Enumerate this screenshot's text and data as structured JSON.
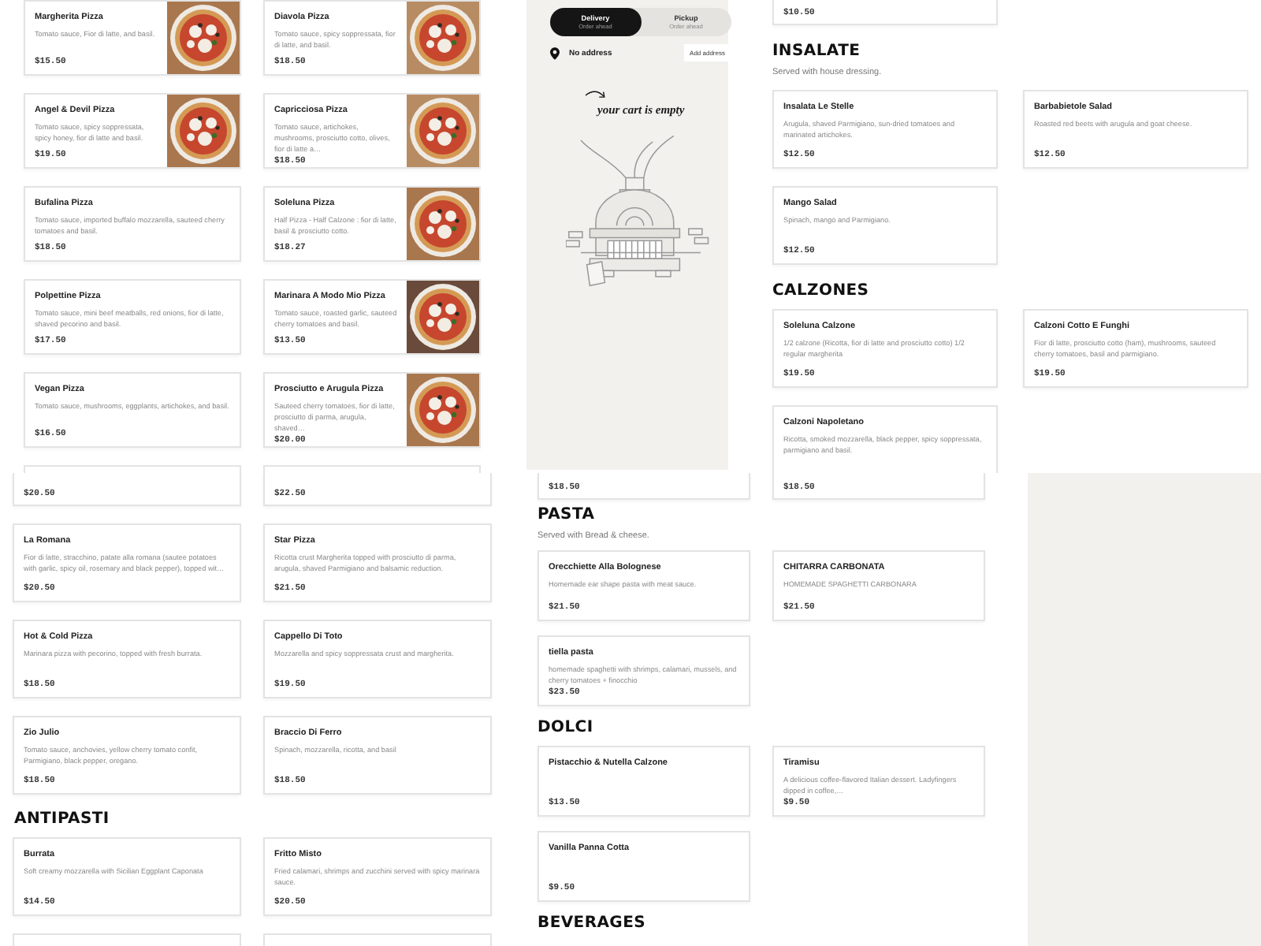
{
  "panels": [
    {
      "kind": "menu",
      "sections": [
        {
          "items": [
            {
              "name": "Margherita Pizza",
              "description": "Tomato sauce, Fior di latte, and basil.",
              "price": "$15.50"
            },
            {
              "name": "Diavola Pizza",
              "description": "Tomato sauce, spicy soppressata, fior di latte, and basil.",
              "price": "$18.50"
            },
            {
              "name": "Angel & Devil Pizza",
              "description": "Tomato sauce, spicy soppressata, spicy honey, fior di latte and basil.",
              "price": "$19.50"
            },
            {
              "name": "Capricciosa Pizza",
              "description": "Tomato sauce, artichokes, mushrooms, prosciutto cotto, olives, fior di latte a…",
              "price": "$18.50"
            },
            {
              "kind": "dish",
              "name": "Bufalina Pizza",
              "description": "Tomato sauce, imported buffalo mozzarella, sauteed cherry tomatoes and basil.",
              "price": "$18.50"
            },
            {
              "name": "Soleluna Pizza",
              "description": "Half Pizza - Half Calzone : fior di latte, basil & prosciutto cotto.",
              "price": "$18.27"
            },
            {
              "kind": "dish",
              "name": "Polpettine Pizza",
              "description": "Tomato sauce, mini beef meatballs, red onions, fior di latte, shaved pecorino and basil.",
              "price": "$17.50"
            },
            {
              "name": "Marinara A Modo Mio Pizza",
              "description": "Tomato sauce, roasted garlic, sauteed cherry tomatoes and basil.",
              "price": "$13.50"
            },
            {
              "kind": "dish",
              "name": "Vegan Pizza",
              "description": "Tomato sauce, mushrooms, eggplants, artichokes, and basil.",
              "price": "$16.50"
            },
            {
              "name": "Prosciutto e Arugula Pizza",
              "description": "Sauteed cherry tomatoes, fior di latte, prosciutto di parma, arugula, shaved…",
              "price": "$20.00"
            },
            {
              "kind": "stub"
            },
            {
              "kind": "stub"
            }
          ]
        }
      ]
    },
    {
      "kind": "cart-menu",
      "cart": {
        "modes": [
          {
            "label": "Delivery",
            "note": "Order ahead",
            "selected": true
          },
          {
            "label": "Pickup",
            "note": "Order ahead",
            "selected": false
          }
        ],
        "address": "No address",
        "address_button": "Add address",
        "empty_note": "your cart is empty"
      },
      "sections": [
        {
          "items": [
            {
              "kind": "tail",
              "price": "$10.50"
            }
          ]
        },
        {
          "title": "INSALATE",
          "subtitle": "Served with house dressing.",
          "items": [
            {
              "kind": "dish",
              "name": "Insalata Le Stelle",
              "description": "Arugula, shaved Parmigiano, sun-dried tomatoes and marinated artichokes.",
              "price": "$12.50"
            },
            {
              "kind": "dish",
              "name": "Barbabietole Salad",
              "description": "Roasted red beets with arugula and goat cheese.",
              "price": "$12.50"
            },
            {
              "kind": "dish",
              "name": "Mango Salad",
              "description": "Spinach, mango and Parmigiano.",
              "price": "$12.50"
            }
          ]
        },
        {
          "title": "CALZONES",
          "items": [
            {
              "kind": "dish",
              "name": "Soleluna Calzone",
              "description": "1/2 calzone (Ricotta, fior di latte and prosciutto cotto) 1/2 regular margherita",
              "price": "$19.50"
            },
            {
              "kind": "dish",
              "name": "Calzoni Cotto E Funghi",
              "description": "Fior di latte, prosciutto cotto (ham), mushrooms, sauteed cherry tomatoes, basil and parmigiano.",
              "price": "$19.50"
            },
            {
              "kind": "dish",
              "name": "Calzoni Napoletano",
              "description": "Ricotta, smoked mozzarella, black pepper, spicy soppressata, parmigiano and basil."
            }
          ]
        }
      ]
    },
    {
      "kind": "menu",
      "sections": [
        {
          "items": [
            {
              "kind": "tail",
              "price": "$20.50"
            },
            {
              "kind": "tail",
              "price": "$22.50"
            },
            {
              "kind": "dish",
              "name": "La Romana",
              "description": "Fior di latte, stracchino, patate alla romana (sautee potatoes with garlic, spicy oil, rosemary and black pepper), topped wit…",
              "price": "$20.50"
            },
            {
              "kind": "dish",
              "name": "Star Pizza",
              "description": "Ricotta crust Margherita topped with prosciutto di parma, arugula, shaved Parmigiano and balsamic reduction.",
              "price": "$21.50"
            },
            {
              "kind": "dish",
              "name": "Hot & Cold Pizza",
              "description": "Marinara pizza with pecorino, topped with fresh burrata.",
              "price": "$18.50"
            },
            {
              "kind": "dish",
              "name": "Cappello Di Toto",
              "description": "Mozzarella and spicy soppressata crust and margherita.",
              "price": "$19.50"
            },
            {
              "kind": "dish",
              "name": "Zio Julio",
              "description": "Tomato sauce, anchovies, yellow cherry tomato confit, Parmigiano, black pepper, oregano.",
              "price": "$18.50"
            },
            {
              "kind": "dish",
              "name": "Braccio Di Ferro",
              "description": "Spinach, mozzarella, ricotta, and basil",
              "price": "$18.50"
            }
          ]
        },
        {
          "title": "ANTIPASTI",
          "items": [
            {
              "kind": "dish",
              "name": "Burrata",
              "description": "Soft creamy mozzarella with Sicilian Eggplant Caponata",
              "price": "$14.50"
            },
            {
              "kind": "dish",
              "name": "Fritto Misto",
              "description": "Fried calamari, shrimps and zucchini served with spicy marinara sauce.",
              "price": "$20.50"
            },
            {
              "kind": "stub"
            },
            {
              "kind": "stub"
            }
          ]
        }
      ]
    },
    {
      "kind": "menu",
      "sections": [
        {
          "items": [
            {
              "kind": "tail",
              "price": "$18.50"
            },
            {
              "kind": "tail",
              "price": "$18.50"
            }
          ]
        },
        {
          "title": "PASTA",
          "subtitle": "Served with Bread & cheese.",
          "items": [
            {
              "kind": "dish",
              "name": "Orecchiette Alla Bolognese",
              "description": "Homemade ear shape pasta with meat sauce.",
              "price": "$21.50"
            },
            {
              "kind": "dish",
              "name": "CHITARRA CARBONATA",
              "description": "HOMEMADE SPAGHETTI CARBONARA",
              "price": "$21.50"
            },
            {
              "kind": "dish",
              "name": "tiella pasta",
              "description": "homemade spaghetti with shrimps, calamari, mussels, and cherry tomatoes + finocchio",
              "price": "$23.50"
            }
          ]
        },
        {
          "title": "DOLCI",
          "items": [
            {
              "kind": "dish",
              "name": "Pistacchio & Nutella Calzone",
              "price": "$13.50"
            },
            {
              "kind": "dish",
              "name": "Tiramisu",
              "description": "A delicious coffee-flavored Italian dessert. Ladyfingers dipped in coffee,…",
              "price": "$9.50"
            },
            {
              "kind": "dish",
              "name": "Vanilla Panna Cotta",
              "price": "$9.50"
            }
          ]
        },
        {
          "title": "BEVERAGES"
        }
      ]
    },
    {
      "kind": "blank"
    }
  ]
}
